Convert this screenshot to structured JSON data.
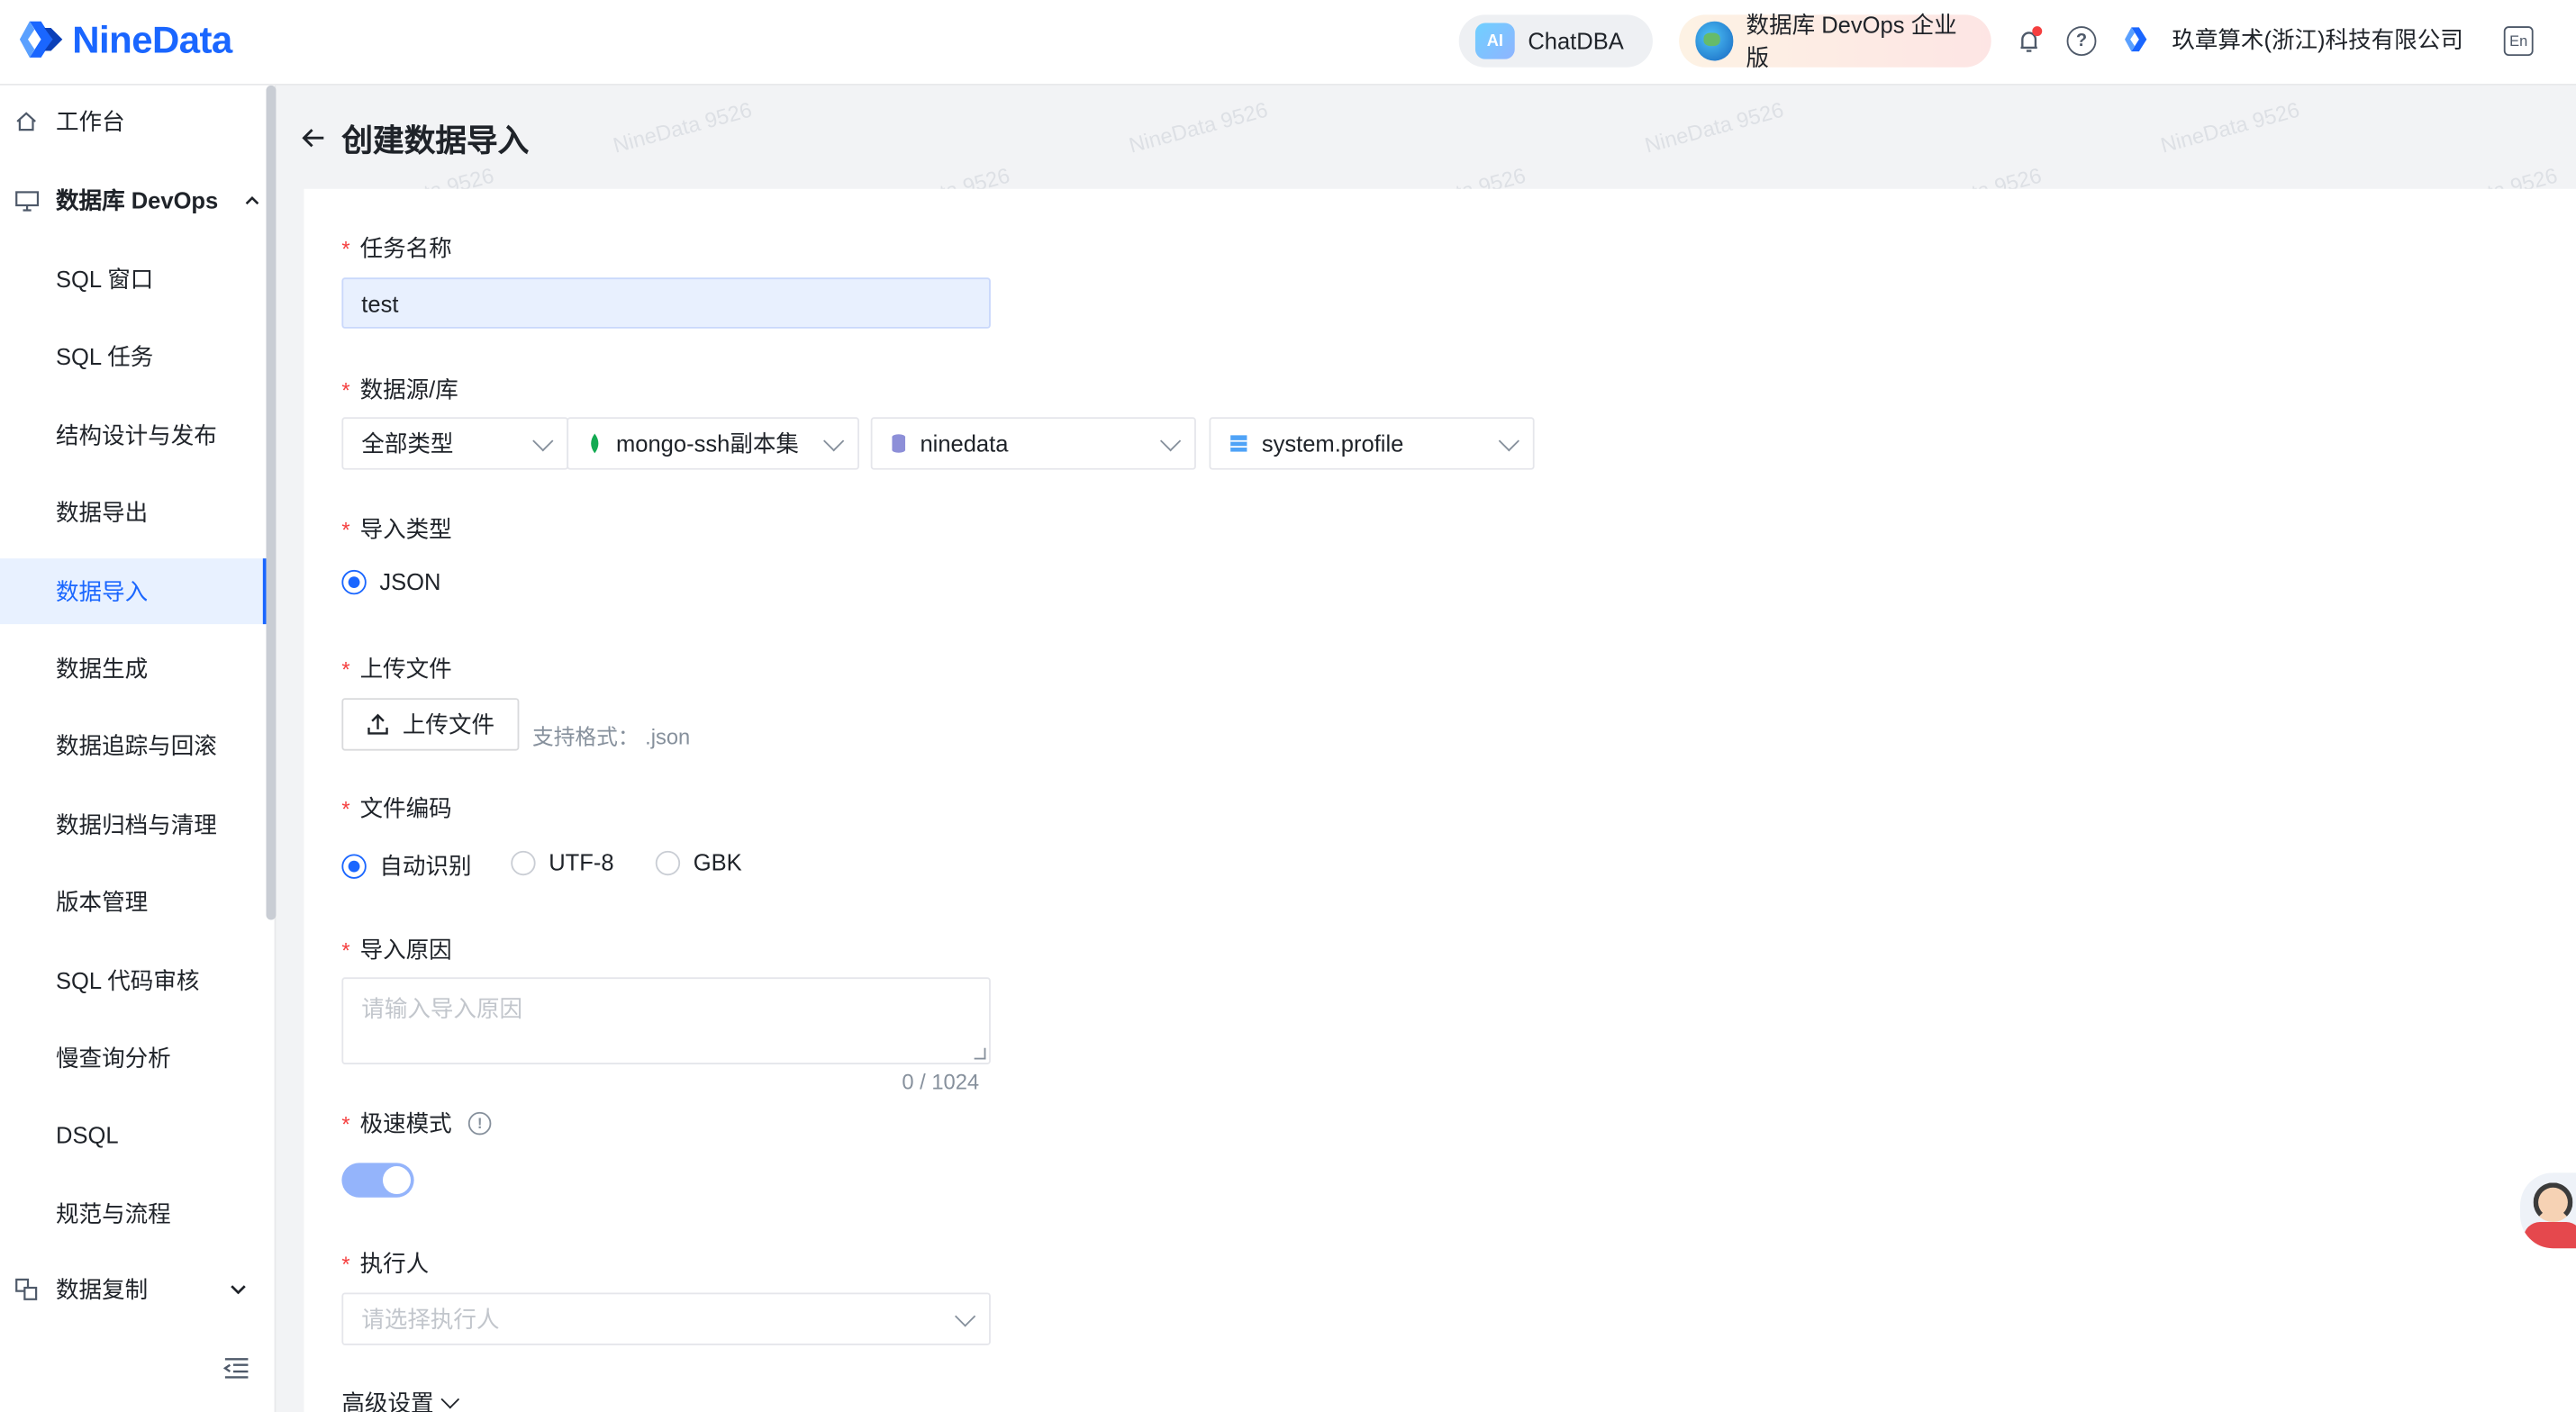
{
  "header": {
    "logo_text": "NineData",
    "chatdba_label": "ChatDBA",
    "chatdba_badge": "AI",
    "edition_label": "数据库 DevOps 企业版",
    "org_name": "玖章算术(浙江)科技有限公司",
    "lang_icon_text": "En"
  },
  "sidebar": {
    "top_item": "工作台",
    "group_label": "数据库 DevOps",
    "items": [
      {
        "label": "SQL 窗口"
      },
      {
        "label": "SQL 任务"
      },
      {
        "label": "结构设计与发布"
      },
      {
        "label": "数据导出"
      },
      {
        "label": "数据导入"
      },
      {
        "label": "数据生成"
      },
      {
        "label": "数据追踪与回滚"
      },
      {
        "label": "数据归档与清理"
      },
      {
        "label": "版本管理"
      },
      {
        "label": "SQL 代码审核"
      },
      {
        "label": "慢查询分析"
      },
      {
        "label": "DSQL"
      },
      {
        "label": "规范与流程"
      }
    ],
    "active_index": 4,
    "bottom_group_label": "数据复制"
  },
  "page": {
    "title": "创建数据导入"
  },
  "form": {
    "task_name": {
      "label": "任务名称",
      "value": "test"
    },
    "datasource": {
      "label": "数据源/库",
      "type_select": "全部类型",
      "source_select": "mongo-ssh副本集",
      "db_select": "ninedata",
      "collection_select": "system.profile"
    },
    "import_type": {
      "label": "导入类型",
      "options": [
        "JSON"
      ],
      "selected": "JSON"
    },
    "upload": {
      "label": "上传文件",
      "button_label": "上传文件",
      "hint": "支持格式：  .json"
    },
    "encoding": {
      "label": "文件编码",
      "options": [
        "自动识别",
        "UTF-8",
        "GBK"
      ],
      "selected": "自动识别"
    },
    "reason": {
      "label": "导入原因",
      "placeholder": "请输入导入原因",
      "counter": "0 / 1024"
    },
    "fast_mode": {
      "label": "极速模式",
      "enabled": true,
      "info_glyph": "!"
    },
    "executor": {
      "label": "执行人",
      "placeholder": "请选择执行人"
    },
    "advanced_label": "高级设置"
  },
  "watermark_text": "NineData 9526",
  "colors": {
    "brand": "#1a66ff",
    "required": "#f53f3f",
    "active_bg": "#e8f1ff",
    "toggle_on": "#94b4fb"
  }
}
